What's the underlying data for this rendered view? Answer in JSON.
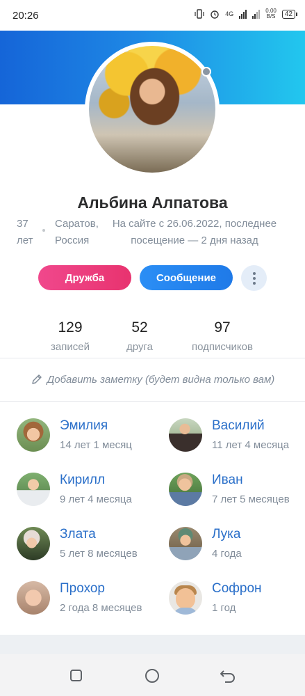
{
  "status_bar": {
    "time": "20:26",
    "network": "4G",
    "net_speed_value": "0,00",
    "net_speed_unit": "B/S",
    "battery": "42"
  },
  "profile": {
    "name": "Альбина Алпатова",
    "age": "37 лет",
    "city": "Саратов, Россия",
    "visit": "На сайте с 26.06.2022, последнее посещение — 2 дня назад",
    "online_status_color": "#8a96a3"
  },
  "actions": {
    "friend_label": "Дружба",
    "message_label": "Сообщение",
    "more_icon": "more-vertical-icon"
  },
  "stats": [
    {
      "value": "129",
      "label": "записей"
    },
    {
      "value": "52",
      "label": "друга"
    },
    {
      "value": "97",
      "label": "подписчиков"
    }
  ],
  "note": {
    "label": "Добавить заметку (будет видна только вам)",
    "icon": "pencil-icon"
  },
  "children": [
    {
      "name": "Эмилия",
      "age": "14 лет 1 месяц"
    },
    {
      "name": "Василий",
      "age": "11 лет 4 месяца"
    },
    {
      "name": "Кирилл",
      "age": "9 лет 4 месяца"
    },
    {
      "name": "Иван",
      "age": "7 лет 5 месяцев"
    },
    {
      "name": "Злата",
      "age": "5 лет 8 месяцев"
    },
    {
      "name": "Лука",
      "age": "4 года"
    },
    {
      "name": "Прохор",
      "age": "2 года 8 месяцев"
    },
    {
      "name": "Софрон",
      "age": "1 год"
    }
  ],
  "colors": {
    "accent_blue": "#2a6fc9",
    "friend_button": "#e8336f",
    "message_button": "#1f7ae8",
    "cover_start": "#1565d8",
    "cover_end": "#22c7ee"
  },
  "nav_bar": {
    "icons": [
      "recent-apps-icon",
      "home-icon",
      "back-icon"
    ]
  }
}
